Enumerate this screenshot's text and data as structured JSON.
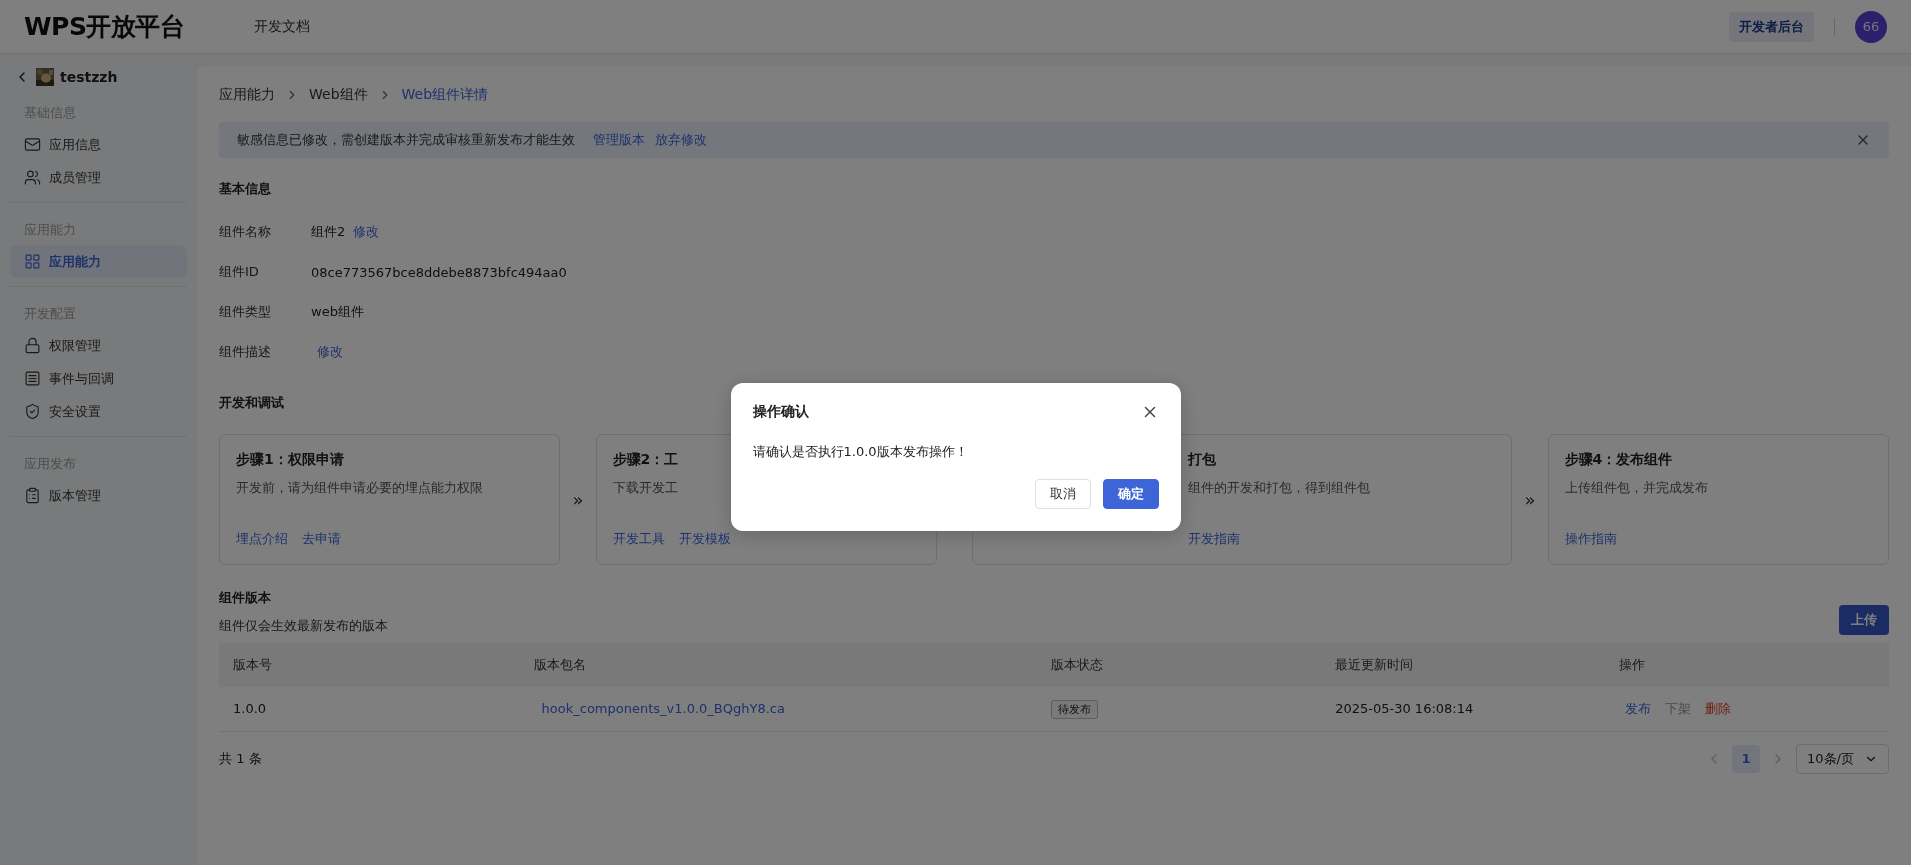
{
  "header": {
    "logo": "WPS开放平台",
    "nav": [
      "开发文档"
    ],
    "console_button": "开发者后台",
    "avatar": "66"
  },
  "sidebar": {
    "app_name": "testzzh",
    "sections": [
      {
        "title": "基础信息",
        "items": [
          {
            "label": "应用信息",
            "selected": false
          },
          {
            "label": "成员管理",
            "selected": false
          }
        ]
      },
      {
        "title": "应用能力",
        "items": [
          {
            "label": "应用能力",
            "selected": true
          }
        ]
      },
      {
        "title": "开发配置",
        "items": [
          {
            "label": "权限管理",
            "selected": false
          },
          {
            "label": "事件与回调",
            "selected": false
          },
          {
            "label": "安全设置",
            "selected": false
          }
        ]
      },
      {
        "title": "应用发布",
        "items": [
          {
            "label": "版本管理",
            "selected": false
          }
        ]
      }
    ]
  },
  "breadcrumb": [
    {
      "label": "应用能力",
      "current": false
    },
    {
      "label": "Web组件",
      "current": false
    },
    {
      "label": "Web组件详情",
      "current": true
    }
  ],
  "notice": {
    "text": "敏感信息已修改，需创建版本并完成审核重新发布才能生效",
    "links": [
      "管理版本",
      "放弃修改"
    ]
  },
  "basic_info": {
    "title": "基本信息",
    "fields": [
      {
        "label": "组件名称",
        "value": "组件2",
        "action": "修改"
      },
      {
        "label": "组件ID",
        "value": "08ce773567bce8ddebe8873bfc494aa0"
      },
      {
        "label": "组件类型",
        "value": "web组件"
      },
      {
        "label": "组件描述",
        "action": "修改"
      }
    ]
  },
  "dev": {
    "title": "开发和调试",
    "separator": "»",
    "steps": [
      {
        "title": "步骤1：权限申请",
        "description": "开发前，请为组件申请必要的埋点能力权限",
        "links": [
          "埋点介绍",
          "去申请"
        ],
        "covered": false
      },
      {
        "title": "步骤2：工",
        "description": "下载开发工",
        "links": [
          "开发工具",
          "开发模板"
        ],
        "covered": false
      },
      {
        "title": "打包",
        "description": "组件的开发和打包，得到组件包",
        "links": [
          "开发指南"
        ],
        "covered": true
      },
      {
        "title": "步骤4：发布组件",
        "description": "上传组件包，并完成发布",
        "links": [
          "操作指南"
        ],
        "covered": false
      }
    ]
  },
  "versions": {
    "title": "组件版本",
    "subtitle": "组件仅会生效最新发布的版本",
    "upload_button": "上传",
    "columns": [
      "版本号",
      "版本包名",
      "版本状态",
      "最近更新时间",
      "操作"
    ],
    "rows": [
      {
        "version": "1.0.0",
        "package": "hook_components_v1.0.0_BQghY8.ca",
        "status": "待发布",
        "updated": "2025-05-30 16:08:14",
        "actions": [
          {
            "label": "发布",
            "kind": "normal",
            "disabled": false
          },
          {
            "label": "下架",
            "kind": "normal",
            "disabled": true
          },
          {
            "label": "删除",
            "kind": "danger",
            "disabled": false
          }
        ]
      }
    ],
    "total": "共 1 条",
    "pages": [
      {
        "label": "1",
        "selected": true
      }
    ],
    "page_size": "10条/页"
  },
  "dialog": {
    "title": "操作确认",
    "message": "请确认是否执行1.0.0版本发布操作！",
    "cancel": "取消",
    "confirm": "确定"
  }
}
